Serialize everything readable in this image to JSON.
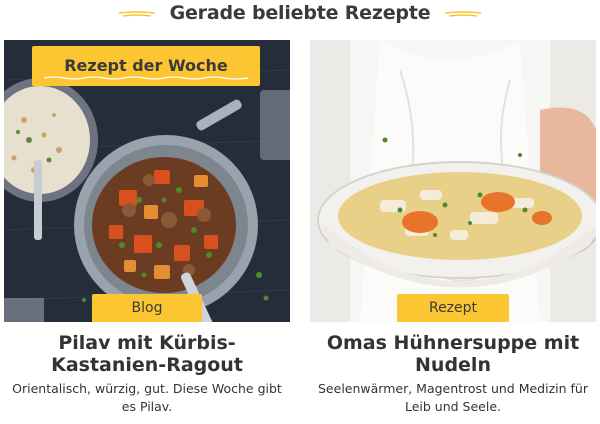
{
  "section": {
    "title": "Gerade beliebte Rezepte"
  },
  "cards": [
    {
      "ribbon": "Rezept der Woche",
      "tag": "Blog",
      "title": "Pilav mit Kürbis-Kastanien-Ragout",
      "description": "Orientalisch, würzig, gut. Diese Woche gibt es Pilav."
    },
    {
      "tag": "Rezept",
      "title": "Omas Hühnersuppe mit Nudeln",
      "description": "Seelenwärmer, Magentrost und Medizin für Leib und Seele."
    }
  ],
  "colors": {
    "accent": "#fbc632",
    "text": "#333333"
  },
  "icons": [
    "title-decoration-left-icon",
    "title-decoration-right-icon"
  ]
}
